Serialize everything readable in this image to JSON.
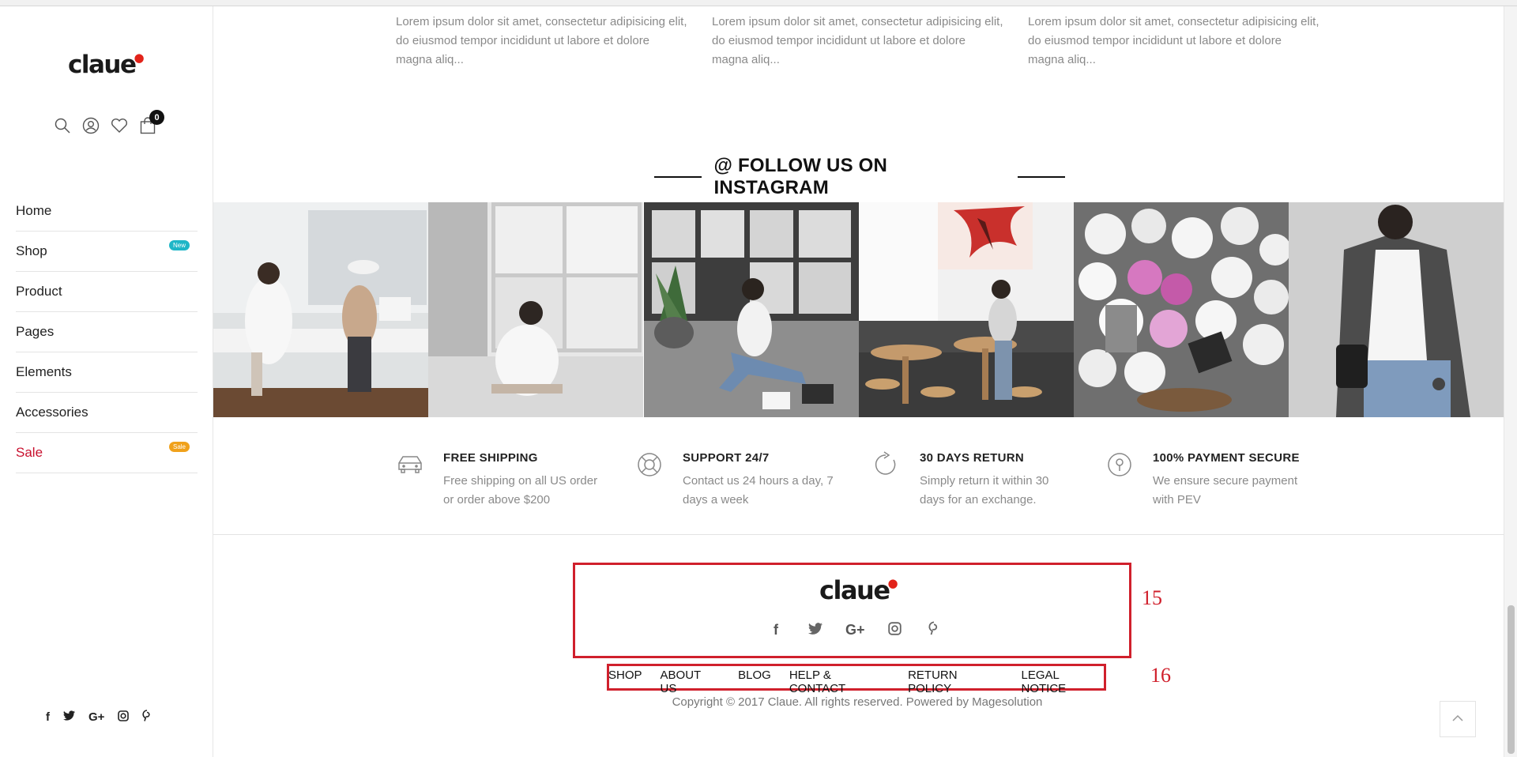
{
  "brand": {
    "logo_text": "claue",
    "accent": "#e2231a"
  },
  "header": {
    "cart_count": "0",
    "icons": [
      "search-icon",
      "user-icon",
      "heart-icon",
      "cart-icon"
    ]
  },
  "menu": [
    {
      "label": "Home"
    },
    {
      "label": "Shop",
      "badge": "New",
      "badge_color": "#1fb6c7"
    },
    {
      "label": "Product"
    },
    {
      "label": "Pages"
    },
    {
      "label": "Elements"
    },
    {
      "label": "Accessories"
    },
    {
      "label": "Sale",
      "badge": "Sale",
      "badge_color": "#f0a11b",
      "color": "#c8102e"
    }
  ],
  "blog_snippets": [
    "Lorem ipsum dolor sit amet, consectetur adipisicing elit, do eiusmod tempor incididunt ut labore et dolore magna aliq...",
    "Lorem ipsum dolor sit amet, consectetur adipisicing elit, do eiusmod tempor incididunt ut labore et dolore magna aliq...",
    "Lorem ipsum dolor sit amet, consectetur adipisicing elit, do eiusmod tempor incididunt ut labore et dolore magna aliq..."
  ],
  "instagram": {
    "title": "@ FOLLOW US ON INSTAGRAM"
  },
  "features": [
    {
      "title": "FREE SHIPPING",
      "desc": [
        "Free shipping on all US order",
        "or order above $200"
      ],
      "icon": "car-icon"
    },
    {
      "title": "SUPPORT 24/7",
      "desc": [
        "Contact us 24 hours a day, 7",
        "days a week"
      ],
      "icon": "lifebuoy-icon"
    },
    {
      "title": "30 DAYS RETURN",
      "desc": [
        "Simply return it within 30",
        "days for an exchange."
      ],
      "icon": "refresh-icon"
    },
    {
      "title": "100% PAYMENT SECURE",
      "desc": [
        "We ensure secure payment",
        "with PEV"
      ],
      "icon": "lock-icon"
    }
  ],
  "footer": {
    "logo_text": "claue",
    "social": [
      "f",
      "t",
      "G+",
      "ig",
      "p"
    ],
    "links": [
      "SHOP",
      "ABOUT US",
      "BLOG",
      "HELP & CONTACT",
      "RETURN POLICY",
      "LEGAL NOTICE"
    ],
    "copyright": "Copyright © 2017 Claue. All rights reserved. Powered by Magesolution"
  },
  "annotations": {
    "box15": "15",
    "box16": "16"
  },
  "sidebar_social": [
    "f",
    "t",
    "G+",
    "ig",
    "p"
  ]
}
